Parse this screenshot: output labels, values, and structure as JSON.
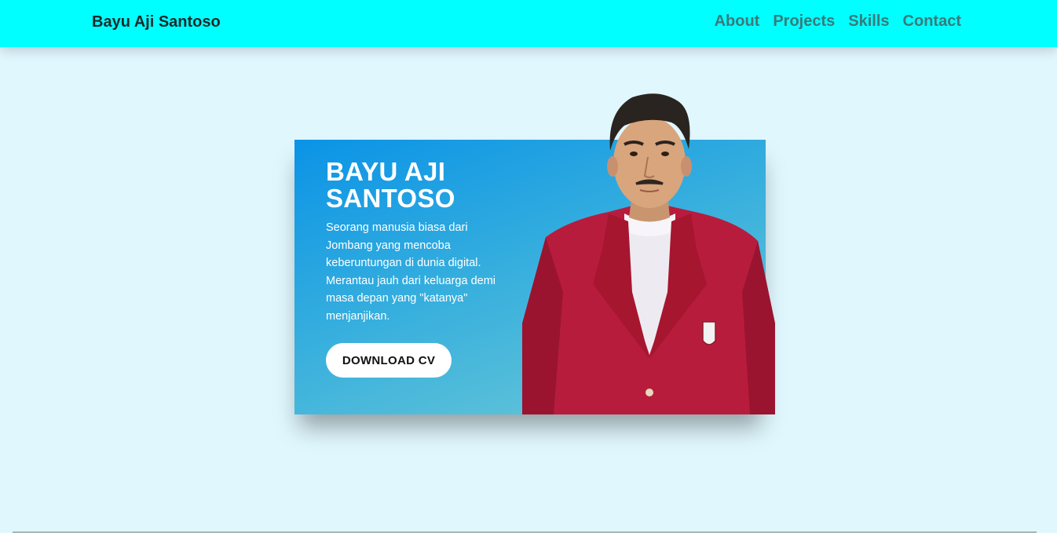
{
  "navbar": {
    "brand": "Bayu Aji Santoso",
    "links": [
      "About",
      "Projects",
      "Skills",
      "Contact"
    ]
  },
  "hero": {
    "title": "BAYU AJI SANTOSO",
    "description": "Seorang manusia biasa dari Jombang yang mencoba keberuntungan di dunia digital. Merantau jauh dari keluarga demi masa depan yang \"katanya\" menjanjikan.",
    "cta_label": "DOWNLOAD CV"
  },
  "colors": {
    "navbar_bg": "#00ffff",
    "page_bg": "#e0f7fe",
    "card_gradient_start": "#0a93e6",
    "card_gradient_end": "#6ecad6",
    "jacket": "#b81c3c"
  }
}
